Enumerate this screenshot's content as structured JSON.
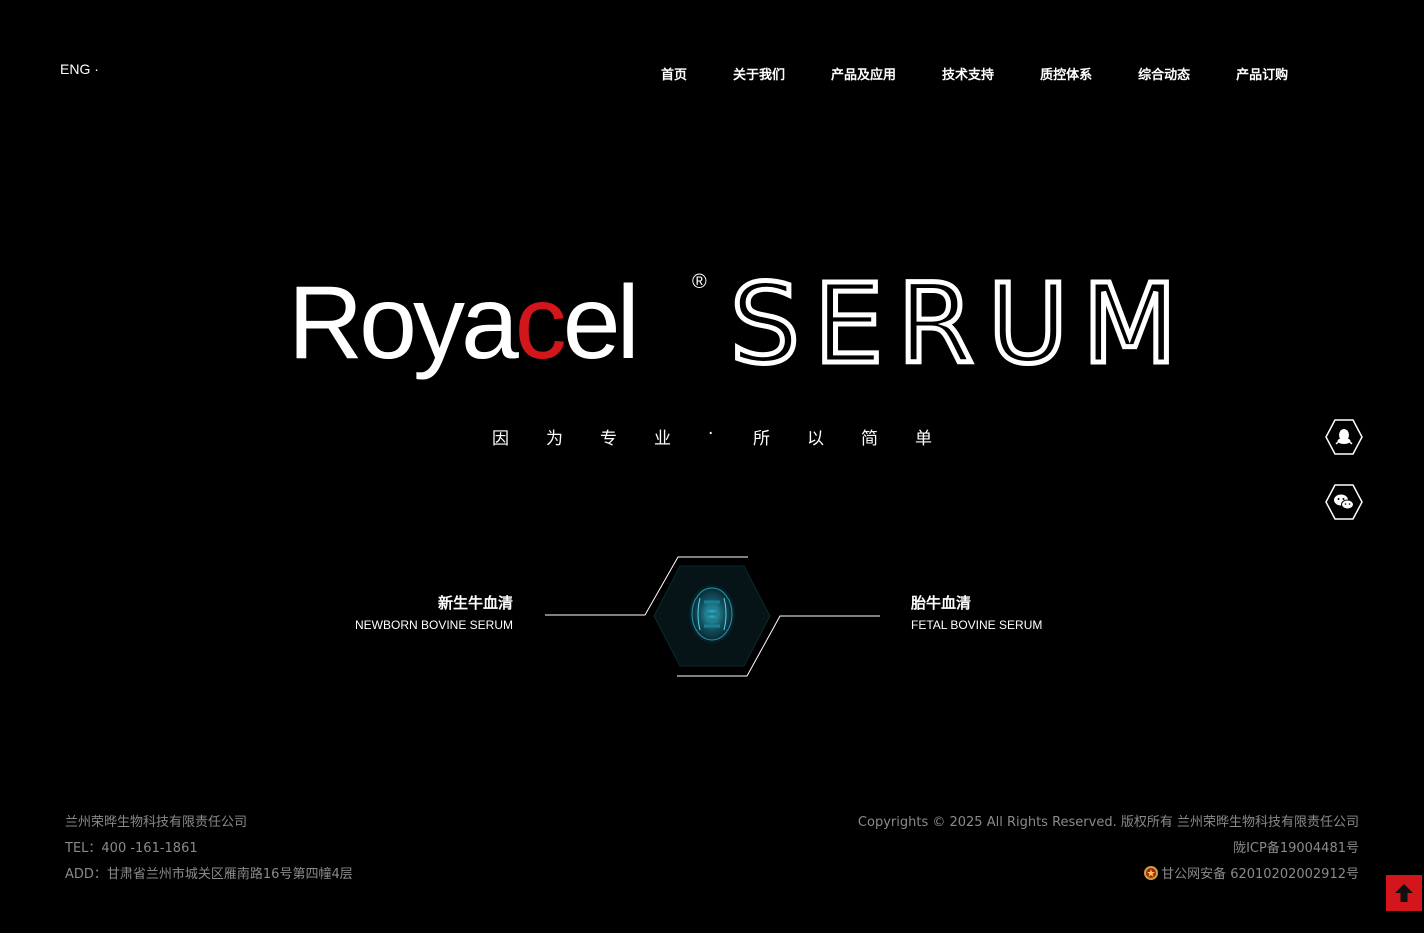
{
  "header": {
    "lang_label": "ENG ·",
    "nav": [
      {
        "label": "首页"
      },
      {
        "label": "关于我们"
      },
      {
        "label": "产品及应用"
      },
      {
        "label": "技术支持"
      },
      {
        "label": "质控体系"
      },
      {
        "label": "综合动态"
      },
      {
        "label": "产品订购"
      }
    ]
  },
  "hero": {
    "brand_prefix": "Roya",
    "brand_accent": "c",
    "brand_suffix": "el",
    "registered_mark": "®",
    "product_word": "SERUM",
    "tagline_chars": [
      "因",
      "为",
      "专",
      "业",
      "·",
      "所",
      "以",
      "简",
      "单"
    ]
  },
  "side": {
    "qq_icon": "qq-icon",
    "wechat_icon": "wechat-icon"
  },
  "products": {
    "left": {
      "cn": "新生牛血清",
      "en": "NEWBORN BOVINE SERUM"
    },
    "right": {
      "cn": "胎牛血清",
      "en": "FETAL BOVINE SERUM"
    }
  },
  "footer": {
    "company": "兰州荣晔生物科技有限责任公司",
    "tel": "TEL：400 -161-1861",
    "address": "ADD：甘肃省兰州市城关区雁南路16号第四幢4层",
    "copyright": "Copyrights © 2025 All Rights Reserved. 版权所有 兰州荣晔生物科技有限责任公司",
    "icp": "陇ICP备19004481号",
    "police": "甘公网安备 62010202002912号"
  },
  "colors": {
    "accent_red": "#d3161b",
    "footer_text": "#8a8a8a",
    "background": "#000000"
  }
}
